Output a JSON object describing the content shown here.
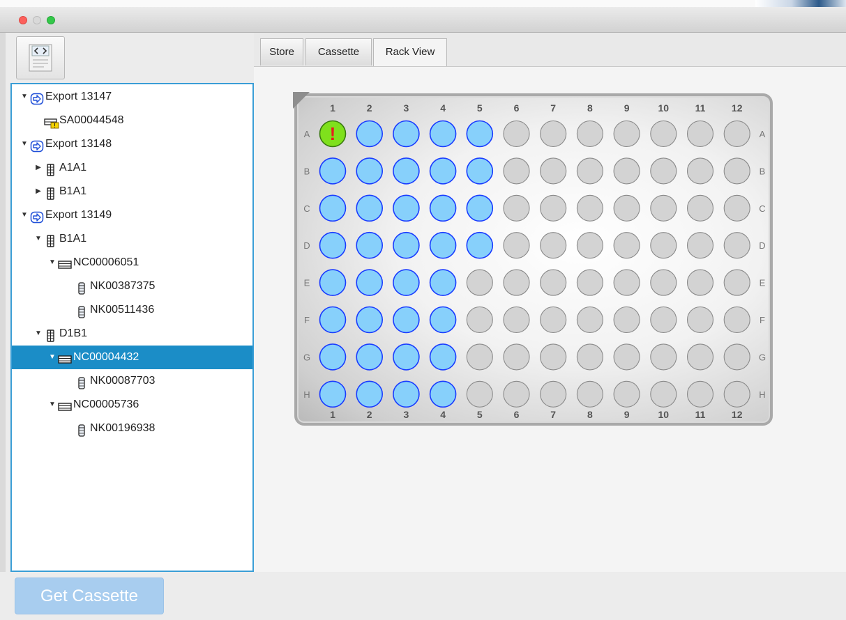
{
  "window": {
    "title": "",
    "controls": [
      "close",
      "minimize",
      "zoom"
    ]
  },
  "toolbar": {
    "button_icon": "code-document-icon"
  },
  "tabs": [
    {
      "label": "Store",
      "active": false
    },
    {
      "label": "Cassette",
      "active": false
    },
    {
      "label": "Rack View",
      "active": true
    }
  ],
  "tree": {
    "items": [
      {
        "label": "Export 13147",
        "icon": "export-arrow-icon",
        "expanded": true,
        "level": 0
      },
      {
        "label": "SA00044548",
        "icon": "sample-warning-icon",
        "level": 1
      },
      {
        "label": "Export 13148",
        "icon": "export-arrow-icon",
        "expanded": true,
        "level": 0
      },
      {
        "label": "A1A1",
        "icon": "rack-icon",
        "expanded": false,
        "level": 1
      },
      {
        "label": "B1A1",
        "icon": "rack-icon",
        "expanded": false,
        "level": 1
      },
      {
        "label": "Export 13149",
        "icon": "export-arrow-icon",
        "expanded": true,
        "level": 0
      },
      {
        "label": "B1A1",
        "icon": "rack-icon",
        "expanded": true,
        "level": 1
      },
      {
        "label": "NC00006051",
        "icon": "plate-icon",
        "expanded": true,
        "level": 2
      },
      {
        "label": "NK00387375",
        "icon": "tube-icon",
        "level": 3
      },
      {
        "label": "NK00511436",
        "icon": "tube-icon",
        "level": 3
      },
      {
        "label": "D1B1",
        "icon": "rack-icon",
        "expanded": true,
        "level": 1
      },
      {
        "label": "NC00004432",
        "icon": "plate-icon",
        "expanded": true,
        "level": 2,
        "selected": true
      },
      {
        "label": "NK00087703",
        "icon": "tube-icon",
        "level": 3
      },
      {
        "label": "NC00005736",
        "icon": "plate-icon",
        "expanded": true,
        "level": 2
      },
      {
        "label": "NK00196938",
        "icon": "tube-icon",
        "level": 3
      }
    ]
  },
  "rack": {
    "columns": [
      "1",
      "2",
      "3",
      "4",
      "5",
      "6",
      "7",
      "8",
      "9",
      "10",
      "11",
      "12"
    ],
    "rows": [
      "A",
      "B",
      "C",
      "D",
      "E",
      "F",
      "G",
      "H"
    ],
    "filled_count_per_row": [
      5,
      5,
      5,
      5,
      4,
      4,
      4,
      4
    ],
    "warning_well": "A1",
    "warning_symbol": "!",
    "colors": {
      "filled": "#87d0fb",
      "filled_stroke": "#1a3cff",
      "empty": "#d3d3d3",
      "empty_stroke": "#8a8a8a",
      "warning": "#7fe01c",
      "warning_stroke": "#3a7a10",
      "warning_mark": "#e81c1c"
    }
  },
  "actions": {
    "get_cassette_label": "Get Cassette"
  }
}
